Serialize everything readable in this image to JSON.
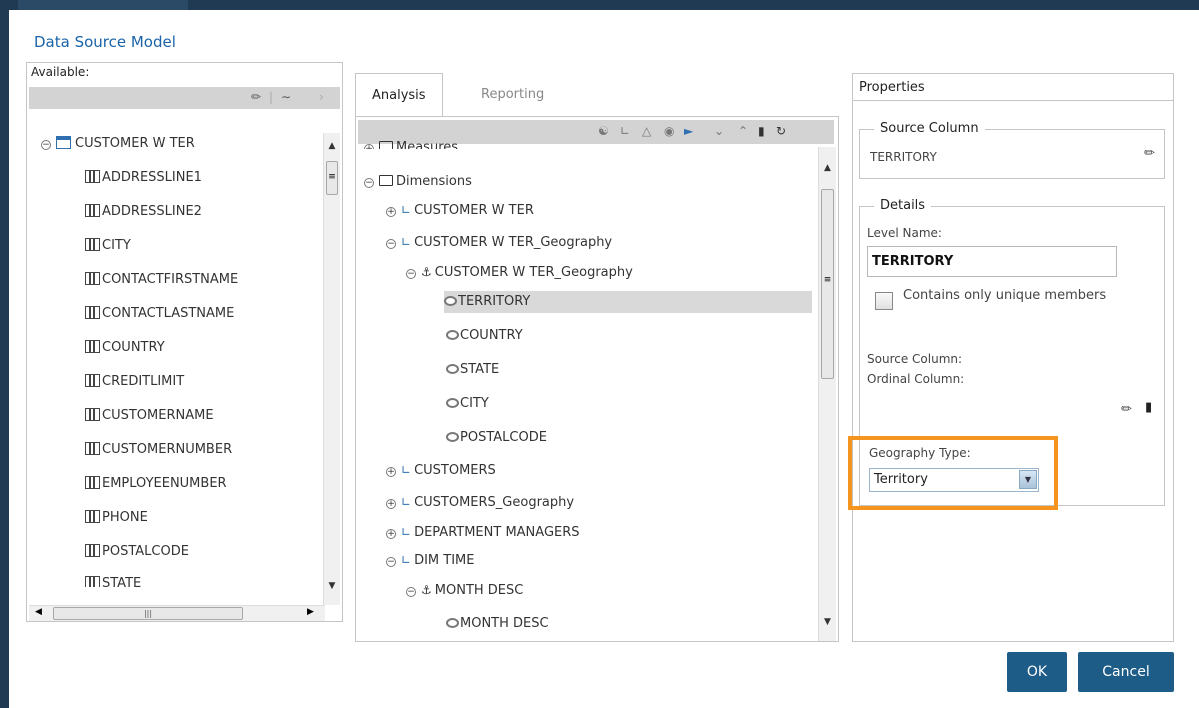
{
  "window": {
    "title": "Data Source Model"
  },
  "available": {
    "label": "Available:",
    "root": "CUSTOMER W TER",
    "columns": [
      "ADDRESSLINE1",
      "ADDRESSLINE2",
      "CITY",
      "CONTACTFIRSTNAME",
      "CONTACTLASTNAME",
      "COUNTRY",
      "CREDITLIMIT",
      "CUSTOMERNAME",
      "CUSTOMERNUMBER",
      "EMPLOYEENUMBER",
      "PHONE",
      "POSTALCODE",
      "STATE"
    ]
  },
  "tabs": {
    "analysis": "Analysis",
    "reporting": "Reporting"
  },
  "analysis_tree": {
    "measures": "Measures",
    "dimensions": "Dimensions",
    "dim1": "CUSTOMER W TER",
    "dim2": "CUSTOMER W TER_Geography",
    "hier2": "CUSTOMER W TER_Geography",
    "levels": [
      "TERRITORY",
      "COUNTRY",
      "STATE",
      "CITY",
      "POSTALCODE"
    ],
    "dim3": "CUSTOMERS",
    "dim4": "CUSTOMERS_Geography",
    "dim5": "DEPARTMENT MANAGERS",
    "dim6": "DIM TIME",
    "hier6": "MONTH DESC",
    "level6": "MONTH DESC"
  },
  "properties": {
    "header": "Properties",
    "source_column": {
      "legend": "Source Column",
      "value": "TERRITORY"
    },
    "details": {
      "legend": "Details",
      "level_name_label": "Level Name:",
      "level_name_value": "TERRITORY",
      "unique_label": "Contains only unique members",
      "unique_checked": false,
      "source_column_label": "Source Column:",
      "ordinal_column_label": "Ordinal Column:",
      "geo_type_label": "Geography Type:",
      "geo_type_value": "Territory"
    }
  },
  "buttons": {
    "ok": "OK",
    "cancel": "Cancel"
  },
  "colors": {
    "accent": "#1d5c86",
    "highlight": "#f5941f",
    "title": "#1a63a8"
  }
}
